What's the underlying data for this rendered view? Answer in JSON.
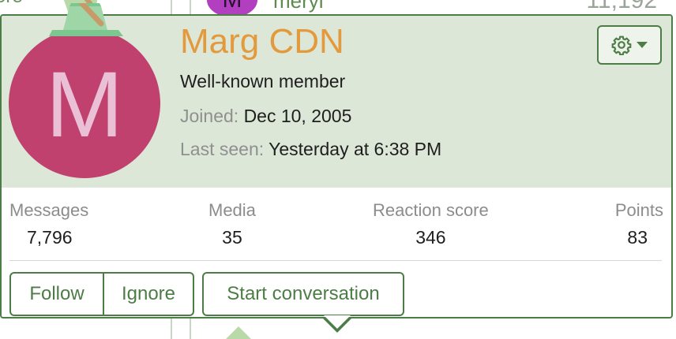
{
  "background": {
    "top_left_text": "ore",
    "avatar_letter": "M",
    "username": "meryl",
    "count": "11,192"
  },
  "profile": {
    "avatar_letter": "M",
    "name": "Marg CDN",
    "title": "Well-known member",
    "joined_label": "Joined:",
    "joined_value": "Dec 10, 2005",
    "last_seen_label": "Last seen:",
    "last_seen_value": "Yesterday at 6:38 PM"
  },
  "stats": [
    {
      "label": "Messages",
      "value": "7,796"
    },
    {
      "label": "Media",
      "value": "35"
    },
    {
      "label": "Reaction score",
      "value": "346"
    },
    {
      "label": "Points",
      "value": "83"
    }
  ],
  "actions": {
    "follow": "Follow",
    "ignore": "Ignore",
    "start_conversation": "Start conversation"
  },
  "icons": {
    "settings": "gear-icon",
    "dropdown": "caret-down-icon"
  },
  "colors": {
    "accent": "#4d7d47",
    "name": "#e39a3c",
    "avatar": "#c0416e",
    "header_bg": "#dde7d8"
  }
}
